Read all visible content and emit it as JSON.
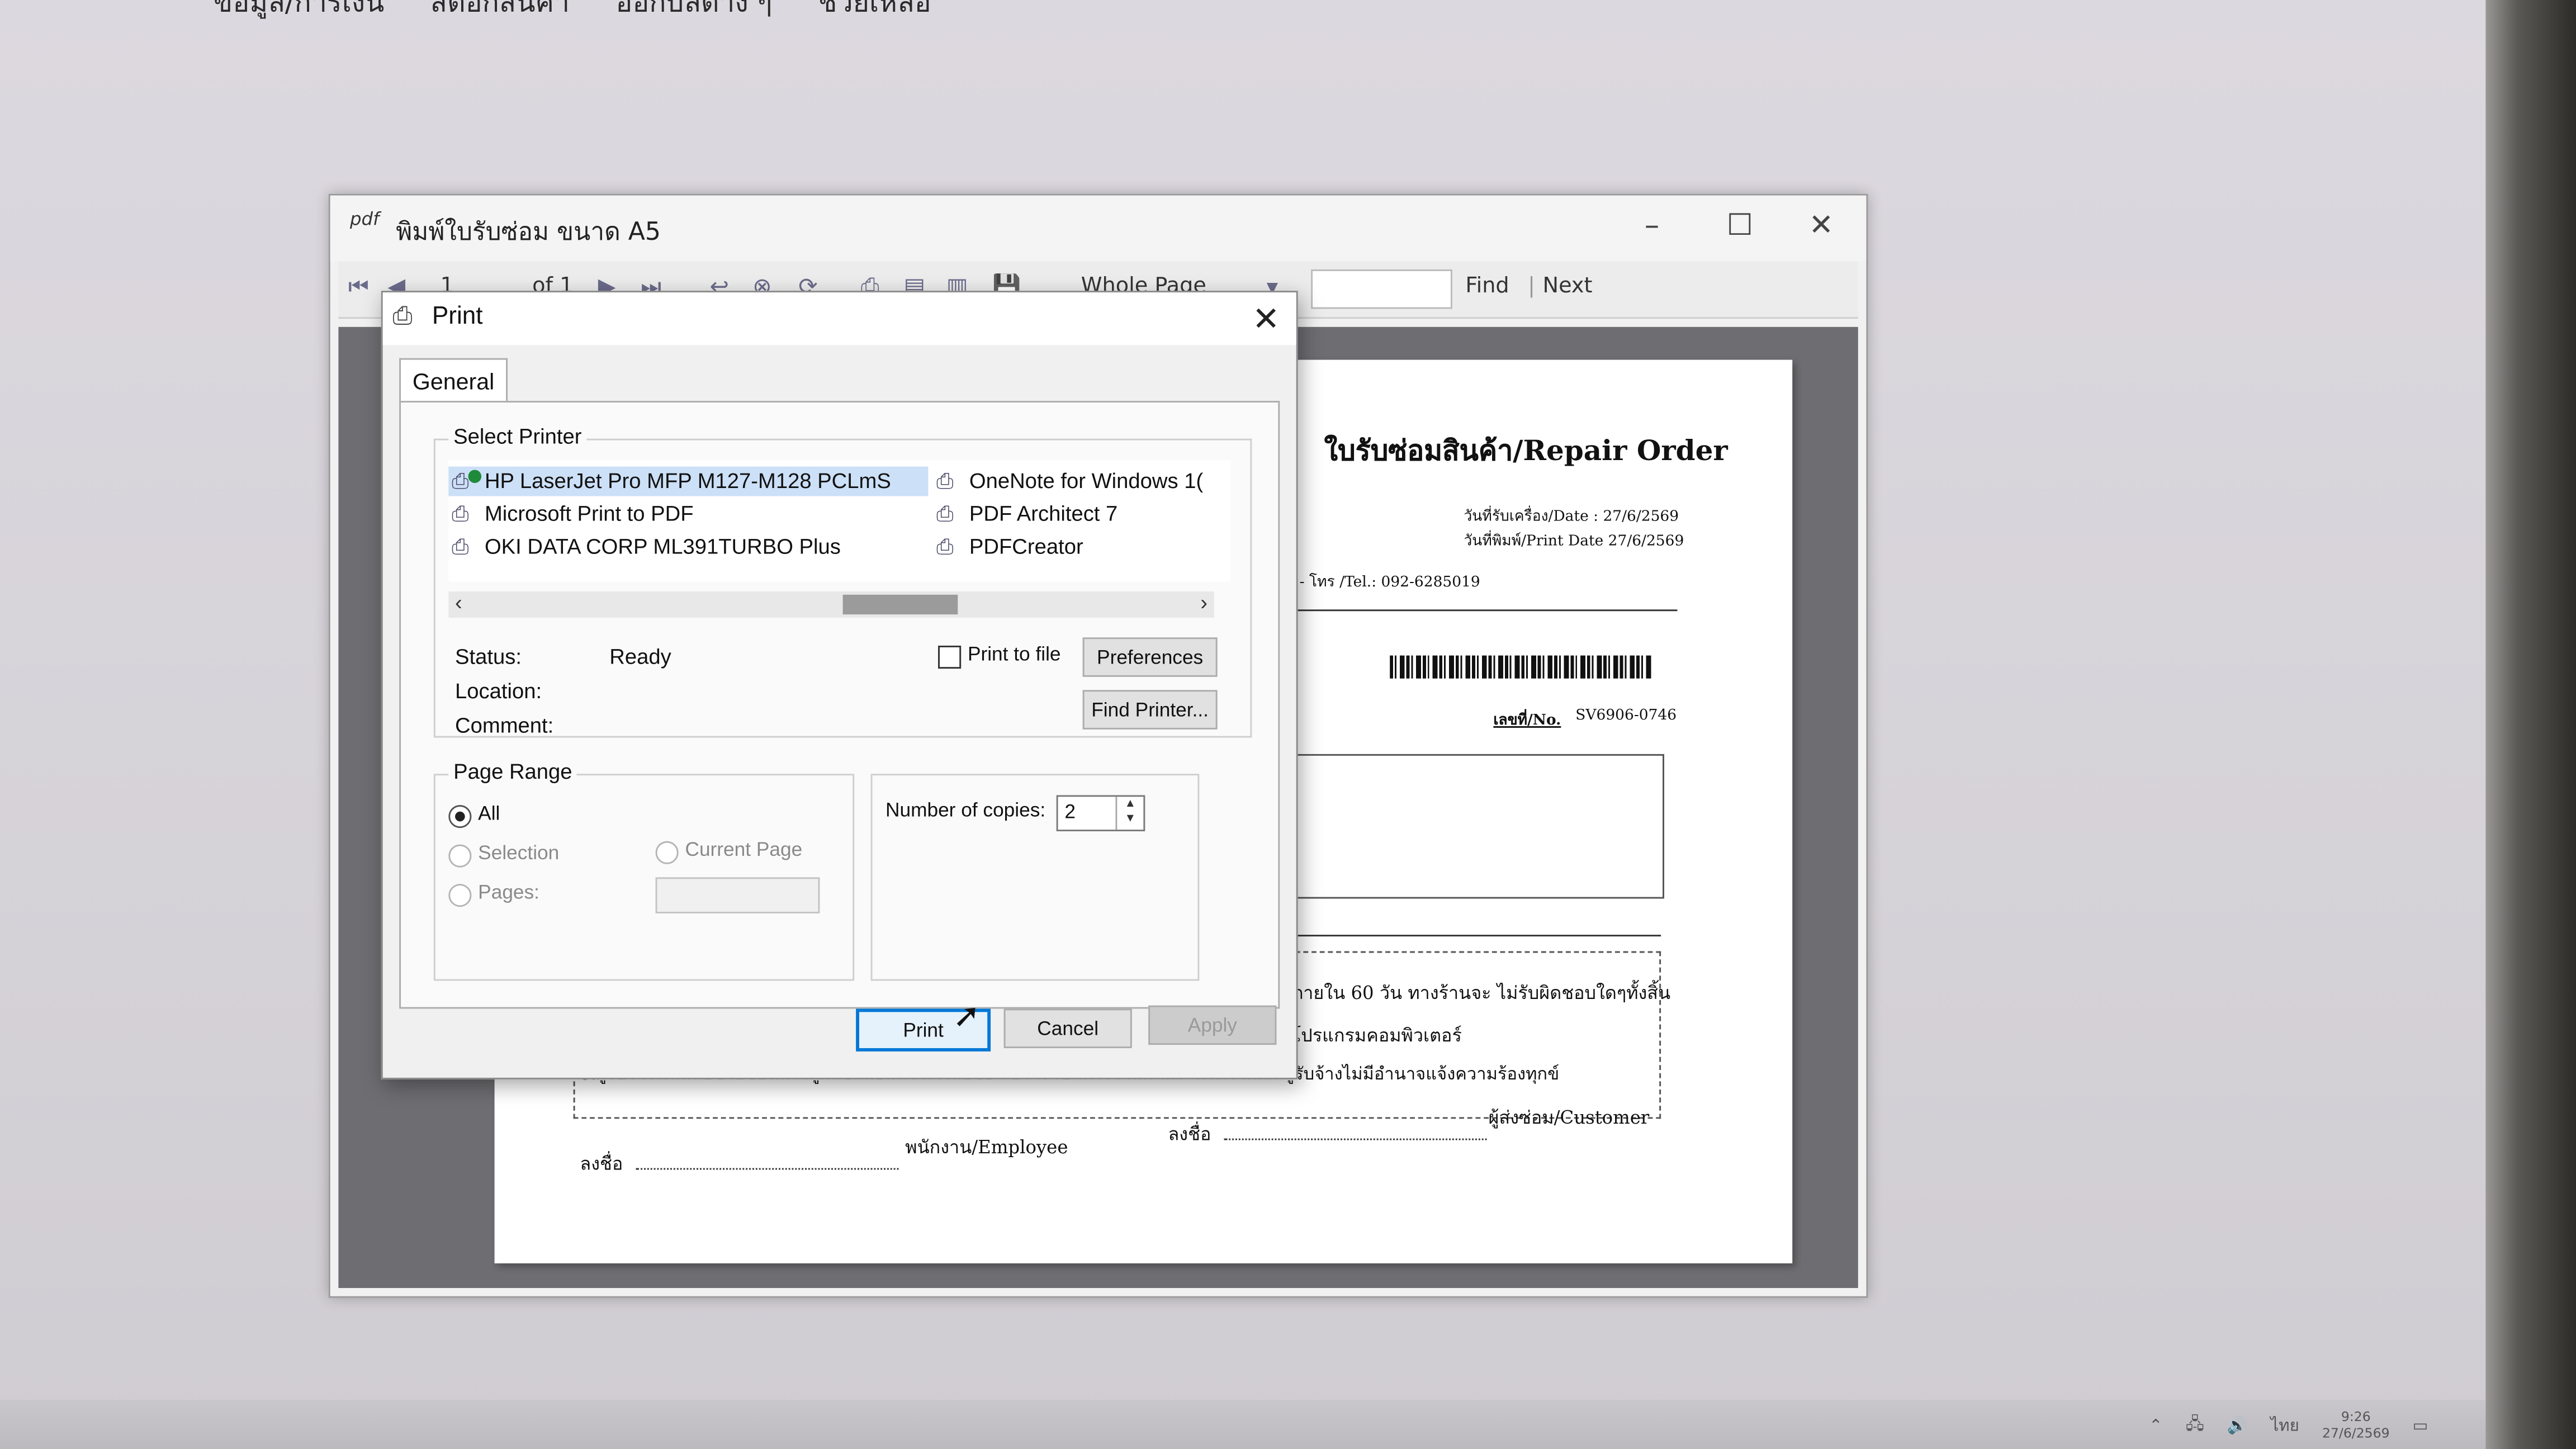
{
  "app_menu": [
    "ข้อมูล/การเงิน",
    "สต็อกสินค้า",
    "ออกบิลต่าง ๆ",
    "ช่วยเหลือ"
  ],
  "viewer": {
    "logo": "pdf",
    "title": "พิมพ์ใบรับซ่อม ขนาด A5",
    "page_current": "1",
    "page_of": "of 1",
    "zoom": "Whole Page",
    "find": "Find",
    "next": "Next"
  },
  "document": {
    "title": "ใบรับซ่อมสินค้า/Repair Order",
    "date_received": "วันที่รับเครื่อง/Date : 27/6/2569",
    "date_print": "วันที่พิมพ์/Print Date 27/6/2569",
    "tel": "- โทร /Tel.: 092-6285019",
    "no_label": "เลขที่/No.",
    "no_value": "SV6906-0746",
    "term_1": "ภายใน 60 วัน ทางร้านจะ ไม่รับผิดชอบใดๆทั้งสิ้น",
    "term_2": "โปรแกรมคอมพิวเตอร์",
    "term_3": "3.ผู้รับจ้างได้เสนอขายซอฟแวร์ถูกลิขสิทธิ์แล้ว การล่อซื้อ ล่อจ้าง เป็นการร่วมกันกระทำความผิด ผู้รับจ้างไม่มีอำนาจแจ้งความร้องทุกข์",
    "sign_employee_prefix": "ลงชื่อ",
    "sign_employee": "พนักงาน/Employee",
    "sign_customer_prefix": "ลงชื่อ",
    "sign_customer": "ผู้ส่งซ่อม/Customer"
  },
  "dialog": {
    "title": "Print",
    "tab": "General",
    "select_printer_label": "Select Printer",
    "printers": [
      {
        "name": "HP LaserJet Pro MFP M127-M128 PCLmS",
        "selected": true
      },
      {
        "name": "Microsoft Print to PDF",
        "selected": false
      },
      {
        "name": "OKI DATA CORP ML391TURBO Plus",
        "selected": false
      },
      {
        "name": "OneNote for Windows 1(",
        "selected": false
      },
      {
        "name": "PDF Architect 7",
        "selected": false
      },
      {
        "name": "PDFCreator",
        "selected": false
      }
    ],
    "status_label": "Status:",
    "status_value": "Ready",
    "location_label": "Location:",
    "comment_label": "Comment:",
    "print_to_file": "Print to file",
    "preferences": "Preferences",
    "find_printer": "Find Printer...",
    "page_range_label": "Page Range",
    "range_all": "All",
    "range_selection": "Selection",
    "range_current": "Current Page",
    "range_pages": "Pages:",
    "copies_label": "Number of copies:",
    "copies_value": "2",
    "print_button": "Print",
    "cancel_button": "Cancel",
    "apply_button": "Apply"
  },
  "taskbar": {
    "lang": "ไทย",
    "time": "9:26",
    "date": "27/6/2569"
  },
  "colors": {
    "selection": "#cce0f7",
    "accent_border": "#0078d7",
    "viewer_bg": "#6e6e72"
  }
}
